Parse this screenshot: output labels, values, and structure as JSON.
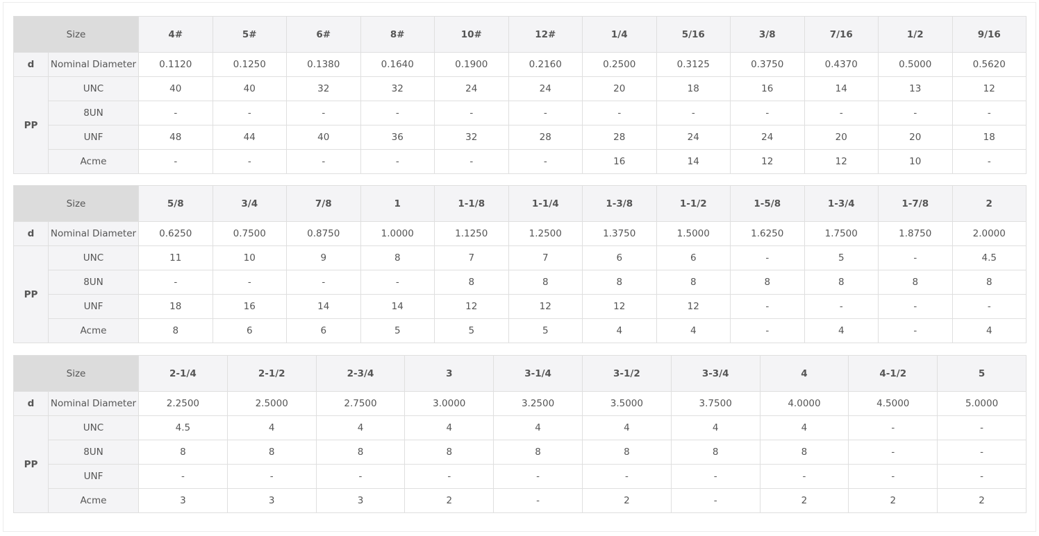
{
  "tables": [
    {
      "size_label": "Size",
      "sizes": [
        "4#",
        "5#",
        "6#",
        "8#",
        "10#",
        "12#",
        "1/4",
        "5/16",
        "3/8",
        "7/16",
        "1/2",
        "9/16"
      ],
      "d_label": "d",
      "pp_label": "PP",
      "rows": [
        {
          "label": "Nominal Diameter",
          "values": [
            "0.1120",
            "0.1250",
            "0.1380",
            "0.1640",
            "0.1900",
            "0.2160",
            "0.2500",
            "0.3125",
            "0.3750",
            "0.4370",
            "0.5000",
            "0.5620"
          ]
        },
        {
          "label": "UNC",
          "values": [
            "40",
            "40",
            "32",
            "32",
            "24",
            "24",
            "20",
            "18",
            "16",
            "14",
            "13",
            "12"
          ]
        },
        {
          "label": "8UN",
          "values": [
            "-",
            "-",
            "-",
            "-",
            "-",
            "-",
            "-",
            "-",
            "-",
            "-",
            "-",
            "-"
          ]
        },
        {
          "label": "UNF",
          "values": [
            "48",
            "44",
            "40",
            "36",
            "32",
            "28",
            "28",
            "24",
            "24",
            "20",
            "20",
            "18"
          ]
        },
        {
          "label": "Acme",
          "values": [
            "-",
            "-",
            "-",
            "-",
            "-",
            "-",
            "16",
            "14",
            "12",
            "12",
            "10",
            "-"
          ]
        }
      ]
    },
    {
      "size_label": "Size",
      "sizes": [
        "5/8",
        "3/4",
        "7/8",
        "1",
        "1-1/8",
        "1-1/4",
        "1-3/8",
        "1-1/2",
        "1-5/8",
        "1-3/4",
        "1-7/8",
        "2"
      ],
      "d_label": "d",
      "pp_label": "PP",
      "rows": [
        {
          "label": "Nominal Diameter",
          "values": [
            "0.6250",
            "0.7500",
            "0.8750",
            "1.0000",
            "1.1250",
            "1.2500",
            "1.3750",
            "1.5000",
            "1.6250",
            "1.7500",
            "1.8750",
            "2.0000"
          ]
        },
        {
          "label": "UNC",
          "values": [
            "11",
            "10",
            "9",
            "8",
            "7",
            "7",
            "6",
            "6",
            "-",
            "5",
            "-",
            "4.5"
          ]
        },
        {
          "label": "8UN",
          "values": [
            "-",
            "-",
            "-",
            "-",
            "8",
            "8",
            "8",
            "8",
            "8",
            "8",
            "8",
            "8"
          ]
        },
        {
          "label": "UNF",
          "values": [
            "18",
            "16",
            "14",
            "14",
            "12",
            "12",
            "12",
            "12",
            "-",
            "-",
            "-",
            "-"
          ]
        },
        {
          "label": "Acme",
          "values": [
            "8",
            "6",
            "6",
            "5",
            "5",
            "5",
            "4",
            "4",
            "-",
            "4",
            "-",
            "4"
          ]
        }
      ]
    },
    {
      "size_label": "Size",
      "sizes": [
        "2-1/4",
        "2-1/2",
        "2-3/4",
        "3",
        "3-1/4",
        "3-1/2",
        "3-3/4",
        "4",
        "4-1/2",
        "5"
      ],
      "d_label": "d",
      "pp_label": "PP",
      "rows": [
        {
          "label": "Nominal Diameter",
          "values": [
            "2.2500",
            "2.5000",
            "2.7500",
            "3.0000",
            "3.2500",
            "3.5000",
            "3.7500",
            "4.0000",
            "4.5000",
            "5.0000"
          ]
        },
        {
          "label": "UNC",
          "values": [
            "4.5",
            "4",
            "4",
            "4",
            "4",
            "4",
            "4",
            "4",
            "-",
            "-"
          ]
        },
        {
          "label": "8UN",
          "values": [
            "8",
            "8",
            "8",
            "8",
            "8",
            "8",
            "8",
            "8",
            "-",
            "-"
          ]
        },
        {
          "label": "UNF",
          "values": [
            "-",
            "-",
            "-",
            "-",
            "-",
            "-",
            "-",
            "-",
            "-",
            "-"
          ]
        },
        {
          "label": "Acme",
          "values": [
            "3",
            "3",
            "3",
            "2",
            "-",
            "2",
            "-",
            "2",
            "2",
            "2"
          ]
        }
      ]
    }
  ],
  "colors": {
    "size_text": "#3a73d6",
    "header_bg": "#dcdcdc",
    "label_bg": "#f4f4f6",
    "border": "#dfdfdf"
  }
}
